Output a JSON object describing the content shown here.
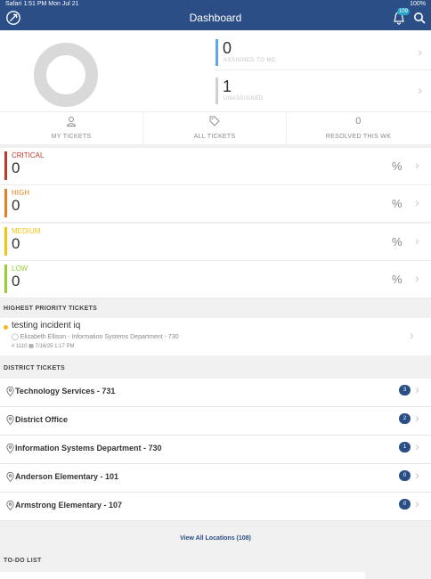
{
  "status_bar": {
    "carrier": "Safari",
    "time": "1:51 PM",
    "date": "Mon Jul 21",
    "battery": "100%"
  },
  "nav": {
    "title": "Dashboard",
    "notification_count": "109"
  },
  "summary": {
    "assigned": {
      "count": "0",
      "label": "ASSIGNED TO ME",
      "color": "#5aa9e6"
    },
    "unassigned": {
      "count": "1",
      "label": "UNASSIGNED",
      "color": "#d0d0d0"
    },
    "tabs": {
      "my_tickets": "MY TICKETS",
      "all_tickets": "ALL TICKETS",
      "resolved_count": "0",
      "resolved": "RESOLVED THIS WK"
    }
  },
  "priorities": [
    {
      "label": "CRITICAL",
      "value": "0",
      "pct": "%",
      "color": "#c0392b"
    },
    {
      "label": "HIGH",
      "value": "0",
      "pct": "%",
      "color": "#e67e22"
    },
    {
      "label": "MEDIUM",
      "value": "0",
      "pct": "%",
      "color": "#f1c40f"
    },
    {
      "label": "LOW",
      "value": "0",
      "pct": "%",
      "color": "#9acd32"
    }
  ],
  "highest_priority": {
    "heading": "HIGHEST PRIORITY TICKETS",
    "ticket": {
      "title": "testing incident iq",
      "requester": "Elizabeth Ellison - Information Systems Department - 730",
      "number": "# 1110",
      "date": "7/16/25 1:17 PM"
    }
  },
  "district": {
    "heading": "DISTRICT TICKETS",
    "locations": [
      {
        "name": "Technology Services - 731",
        "count": "3"
      },
      {
        "name": "District Office",
        "count": "2"
      },
      {
        "name": "Information Systems Department - 730",
        "count": "1"
      },
      {
        "name": "Anderson Elementary - 101",
        "count": "0"
      },
      {
        "name": "Armstrong Elementary - 107",
        "count": "0"
      }
    ],
    "view_all": "View All Locations (108)"
  },
  "todo": {
    "heading": "TO-DO LIST"
  }
}
